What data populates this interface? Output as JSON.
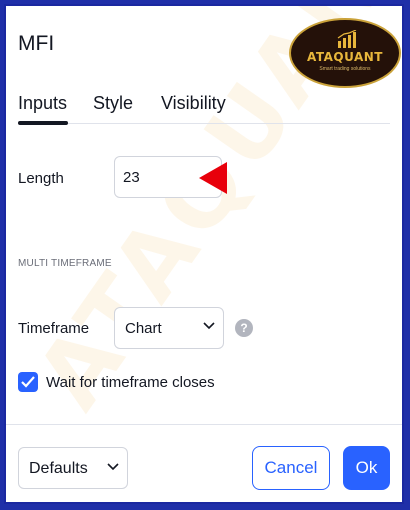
{
  "dialog": {
    "title": "MFI",
    "tabs": [
      {
        "label": "Inputs",
        "active": true
      },
      {
        "label": "Style",
        "active": false
      },
      {
        "label": "Visibility",
        "active": false
      }
    ]
  },
  "logo": {
    "name": "ATAQUANT",
    "tagline": "Smart trading solutions"
  },
  "watermark": "ATAQUANT",
  "inputs": {
    "length_label": "Length",
    "length_value": "23",
    "section_title": "MULTI TIMEFRAME",
    "timeframe_label": "Timeframe",
    "timeframe_value": "Chart",
    "wait_label": "Wait for timeframe closes",
    "wait_checked": true
  },
  "footer": {
    "defaults_label": "Defaults",
    "cancel_label": "Cancel",
    "ok_label": "Ok"
  },
  "colors": {
    "accent": "#2962ff",
    "marker": "#e8000b",
    "border": "#1a28a0",
    "logo_gold": "#e8b73c"
  },
  "icons": {
    "help": "question-circle-icon",
    "dropdown": "chevron-down-icon",
    "check": "checkmark-icon",
    "marker": "red-arrow-marker"
  }
}
